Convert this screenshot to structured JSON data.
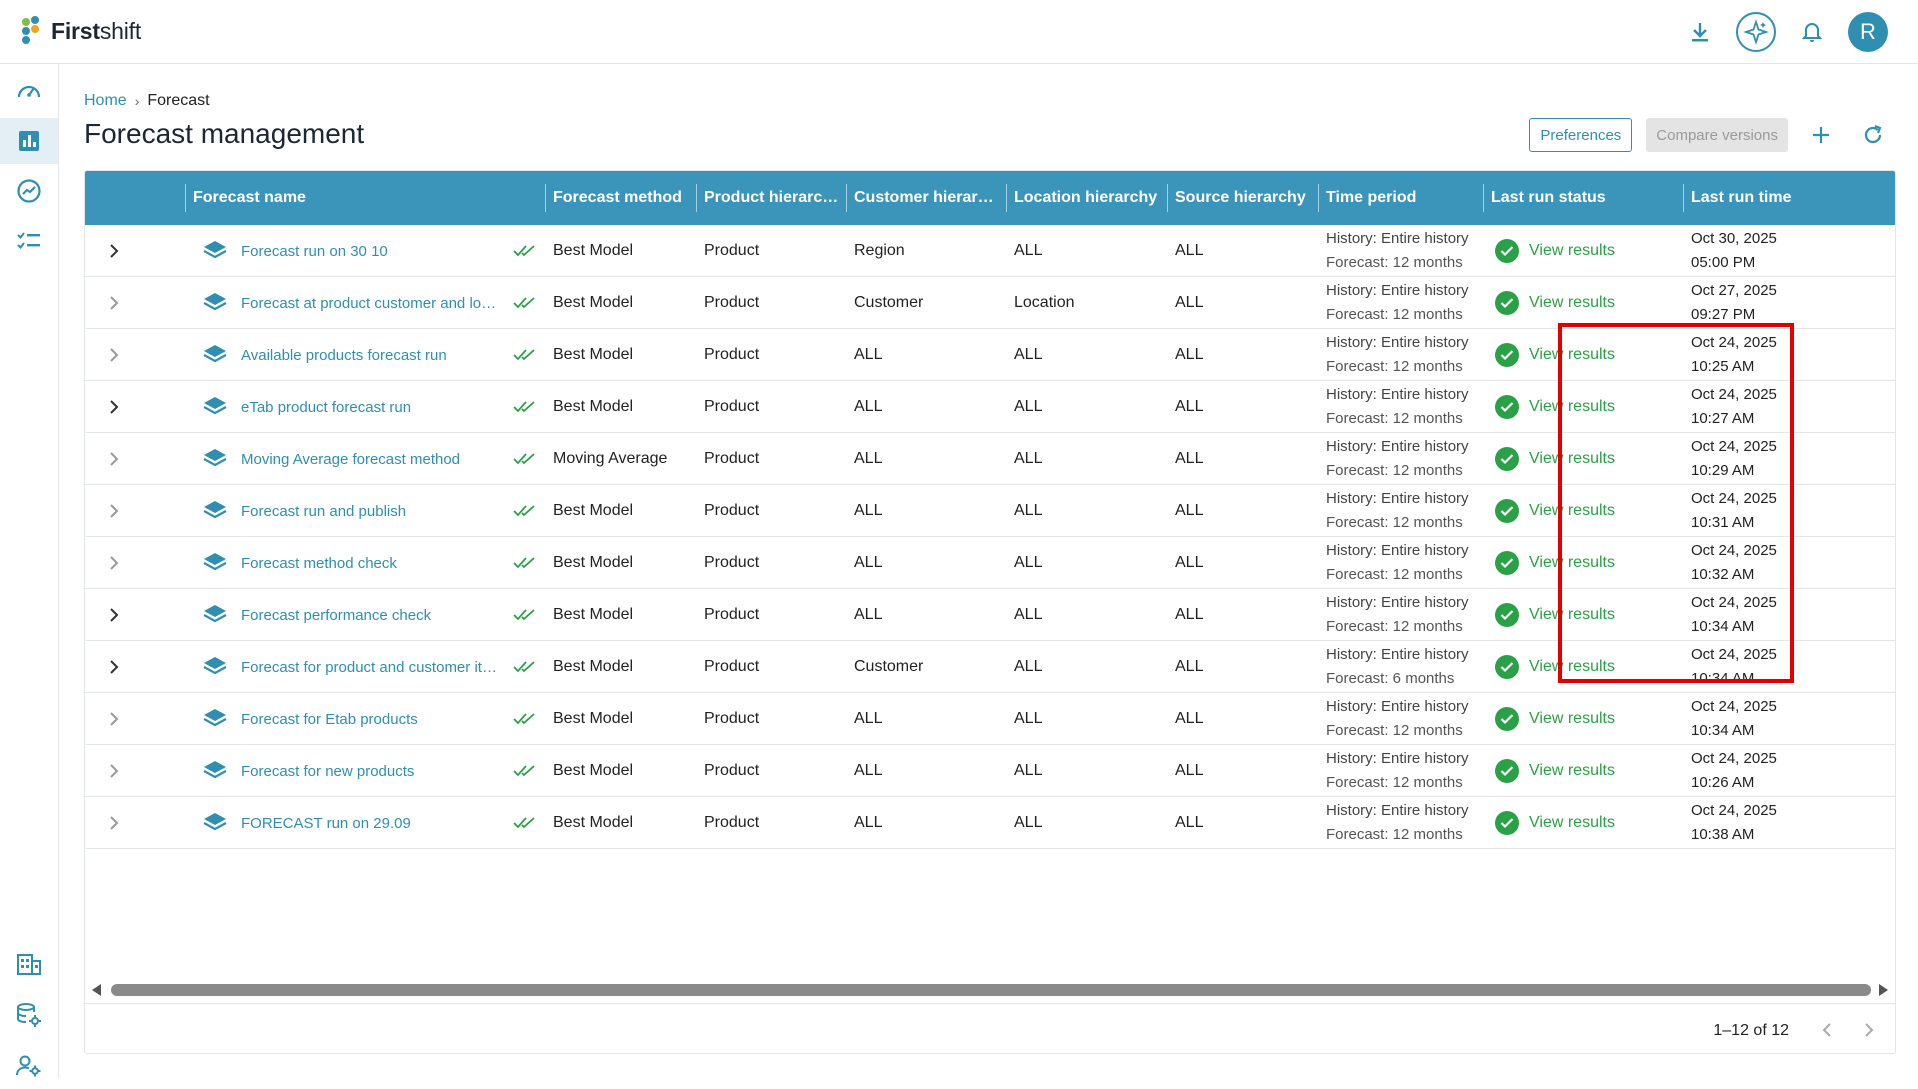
{
  "app": {
    "brand_bold": "First",
    "brand_rest": "shift",
    "avatar_initial": "R"
  },
  "icons": {
    "download": "download-icon",
    "ai": "sparkle-icon",
    "bell": "bell-icon",
    "sidebar": [
      "dashboard-icon",
      "forecast-chart-icon",
      "trend-icon",
      "checklist-icon",
      "building-icon",
      "database-settings-icon",
      "user-settings-icon"
    ]
  },
  "breadcrumb": {
    "home": "Home",
    "sep": "›",
    "current": "Forecast"
  },
  "page": {
    "title": "Forecast management"
  },
  "actions": {
    "preferences": "Preferences",
    "compare": "Compare versions"
  },
  "table": {
    "columns": [
      "Forecast name",
      "Forecast method",
      "Product hierarc…",
      "Customer hierar…",
      "Location hierarchy",
      "Source hierarchy",
      "Time period",
      "Last run status",
      "Last run time"
    ],
    "rows": [
      {
        "name": "Forecast run on 30 10",
        "method": "Best Model",
        "product": "Product",
        "customer": "Region",
        "location": "ALL",
        "source": "ALL",
        "history": "History: Entire history",
        "forecast": "Forecast: 12 months",
        "status": "View results",
        "date": "Oct 30, 2025",
        "time": "05:00 PM"
      },
      {
        "name": "Forecast at product customer and lo…",
        "method": "Best Model",
        "product": "Product",
        "customer": "Customer",
        "location": "Location",
        "source": "ALL",
        "history": "History: Entire history",
        "forecast": "Forecast: 12 months",
        "status": "View results",
        "date": "Oct 27, 2025",
        "time": "09:27 PM"
      },
      {
        "name": "Available products forecast run",
        "method": "Best Model",
        "product": "Product",
        "customer": "ALL",
        "location": "ALL",
        "source": "ALL",
        "history": "History: Entire history",
        "forecast": "Forecast: 12 months",
        "status": "View results",
        "date": "Oct 24, 2025",
        "time": "10:25 AM"
      },
      {
        "name": "eTab product forecast run",
        "method": "Best Model",
        "product": "Product",
        "customer": "ALL",
        "location": "ALL",
        "source": "ALL",
        "history": "History: Entire history",
        "forecast": "Forecast: 12 months",
        "status": "View results",
        "date": "Oct 24, 2025",
        "time": "10:27 AM"
      },
      {
        "name": "Moving Average forecast method",
        "method": "Moving Average",
        "product": "Product",
        "customer": "ALL",
        "location": "ALL",
        "source": "ALL",
        "history": "History: Entire history",
        "forecast": "Forecast: 12 months",
        "status": "View results",
        "date": "Oct 24, 2025",
        "time": "10:29 AM"
      },
      {
        "name": "Forecast run and publish",
        "method": "Best Model",
        "product": "Product",
        "customer": "ALL",
        "location": "ALL",
        "source": "ALL",
        "history": "History: Entire history",
        "forecast": "Forecast: 12 months",
        "status": "View results",
        "date": "Oct 24, 2025",
        "time": "10:31 AM"
      },
      {
        "name": "Forecast method check",
        "method": "Best Model",
        "product": "Product",
        "customer": "ALL",
        "location": "ALL",
        "source": "ALL",
        "history": "History: Entire history",
        "forecast": "Forecast: 12 months",
        "status": "View results",
        "date": "Oct 24, 2025",
        "time": "10:32 AM"
      },
      {
        "name": "Forecast performance check",
        "method": "Best Model",
        "product": "Product",
        "customer": "ALL",
        "location": "ALL",
        "source": "ALL",
        "history": "History: Entire history",
        "forecast": "Forecast: 12 months",
        "status": "View results",
        "date": "Oct 24, 2025",
        "time": "10:34 AM"
      },
      {
        "name": "Forecast for product and customer it…",
        "method": "Best Model",
        "product": "Product",
        "customer": "Customer",
        "location": "ALL",
        "source": "ALL",
        "history": "History: Entire history",
        "forecast": "Forecast: 6 months",
        "status": "View results",
        "date": "Oct 24, 2025",
        "time": "10:34 AM"
      },
      {
        "name": "Forecast for Etab products",
        "method": "Best Model",
        "product": "Product",
        "customer": "ALL",
        "location": "ALL",
        "source": "ALL",
        "history": "History: Entire history",
        "forecast": "Forecast: 12 months",
        "status": "View results",
        "date": "Oct 24, 2025",
        "time": "10:34 AM"
      },
      {
        "name": "Forecast for new products",
        "method": "Best Model",
        "product": "Product",
        "customer": "ALL",
        "location": "ALL",
        "source": "ALL",
        "history": "History: Entire history",
        "forecast": "Forecast: 12 months",
        "status": "View results",
        "date": "Oct 24, 2025",
        "time": "10:26 AM"
      },
      {
        "name": "FORECAST run on 29.09",
        "method": "Best Model",
        "product": "Product",
        "customer": "ALL",
        "location": "ALL",
        "source": "ALL",
        "history": "History: Entire history",
        "forecast": "Forecast: 12 months",
        "status": "View results",
        "date": "Oct 24, 2025",
        "time": "10:38 AM"
      }
    ]
  },
  "pagination": {
    "range": "1–12 of 12"
  },
  "colors": {
    "accent": "#2f8fb1",
    "header_bg": "#3b95bb",
    "success": "#2aa146",
    "highlight": "#e00000"
  }
}
